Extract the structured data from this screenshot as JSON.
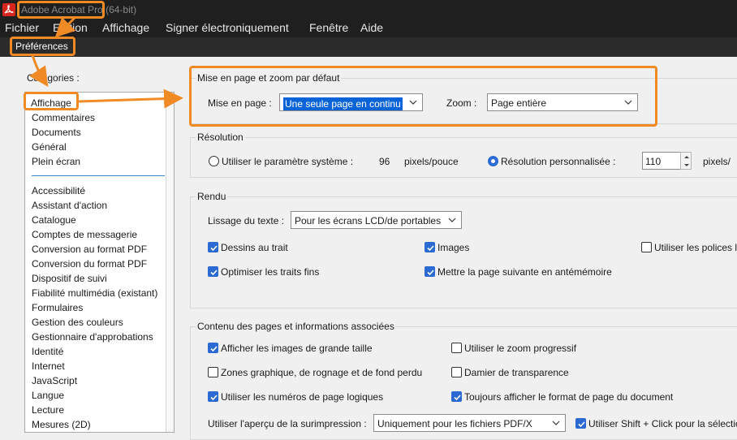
{
  "window": {
    "title": "Adobe Acrobat Pro (64-bit)"
  },
  "menu": {
    "items": [
      "Fichier",
      "Edition",
      "Affichage",
      "Signer électroniquement",
      "Fenêtre",
      "Aide"
    ]
  },
  "prefs_label": "Préférences",
  "categories": {
    "label": "Catégories :",
    "top": [
      "Affichage",
      "Commentaires",
      "Documents",
      "Général",
      "Plein écran"
    ],
    "rest": [
      "Accessibilité",
      "Assistant d'action",
      "Catalogue",
      "Comptes de messagerie",
      "Conversion au format PDF",
      "Conversion du format PDF",
      "Dispositif de suivi",
      "Fiabilité multimédia (existant)",
      "Formulaires",
      "Gestion des couleurs",
      "Gestionnaire d'approbations",
      "Identité",
      "Internet",
      "JavaScript",
      "Langue",
      "Lecture",
      "Mesures (2D)"
    ]
  },
  "layout_zoom": {
    "title": "Mise en page et zoom par défaut",
    "mise_label": "Mise en page :",
    "mise_value": "Une seule page en continu",
    "zoom_label": "Zoom :",
    "zoom_value": "Page entière"
  },
  "resolution": {
    "title": "Résolution",
    "system_label": "Utiliser le paramètre système :",
    "system_value": "96",
    "system_unit": "pixels/pouce",
    "custom_label": "Résolution personnalisée :",
    "custom_value": "110",
    "custom_unit": "pixels/"
  },
  "rendu": {
    "title": "Rendu",
    "smoothing_label": "Lissage du texte :",
    "smoothing_value": "Pour les écrans LCD/de portables",
    "checks": [
      {
        "label": "Dessins au trait",
        "checked": true
      },
      {
        "label": "Images",
        "checked": true
      },
      {
        "label": "Utiliser les polices lo",
        "checked": false
      },
      {
        "label": "Optimiser les traits fins",
        "checked": true
      },
      {
        "label": "Mettre la page suivante en antémémoire",
        "checked": true
      }
    ]
  },
  "contenu": {
    "title": "Contenu des pages et informations associées",
    "checks": [
      {
        "label": "Afficher les images de grande taille",
        "checked": true
      },
      {
        "label": "Utiliser le zoom progressif",
        "checked": false
      },
      {
        "label": "Zones graphique, de rognage et de fond perdu",
        "checked": false
      },
      {
        "label": "Damier de transparence",
        "checked": false
      },
      {
        "label": "Utiliser les numéros de page logiques",
        "checked": true
      },
      {
        "label": "Toujours afficher le format de page du document",
        "checked": true
      }
    ],
    "overprint_label": "Utiliser l'aperçu de la surimpression :",
    "overprint_value": "Uniquement pour les fichiers PDF/X",
    "shift_label": "Utiliser Shift + Click pour la sélectio",
    "shift_checked": true
  },
  "colors": {
    "accent": "#f08a24",
    "checkbox": "#2a6ad2",
    "titlebar": "#1f1f1f",
    "selection": "#0a64d8"
  }
}
